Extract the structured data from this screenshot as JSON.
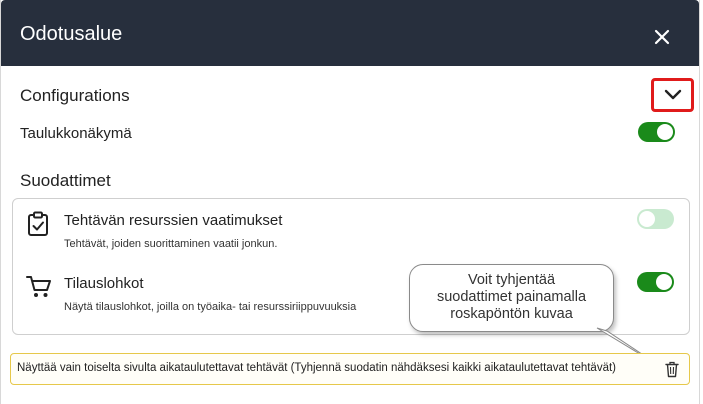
{
  "dialog": {
    "title": "Odotusalue",
    "close_icon": "close-icon"
  },
  "configurations": {
    "heading": "Configurations",
    "collapse_icon": "chevron-down-icon",
    "table_view": {
      "label": "Taulukkonäkymä",
      "enabled": true
    }
  },
  "filters": {
    "heading": "Suodattimet",
    "items": [
      {
        "icon": "clipboard-check-icon",
        "title": "Tehtävän resurssien vaatimukset",
        "description": "Tehtävät, joiden suorittaminen vaatii jonkun.",
        "enabled": false
      },
      {
        "icon": "shopping-cart-icon",
        "title": "Tilauslohkot",
        "description": "Näytä tilauslohkot, joilla on työaika- tai resurssiriippuvuuksia",
        "enabled": true
      }
    ]
  },
  "tooltip": {
    "lines": [
      "Voit tyhjentää",
      "suodattimet painamalla",
      "roskapöntön kuvaa"
    ]
  },
  "notice": {
    "text": "Näyttää vain toiselta sivulta aikataulutettavat tehtävät (Tyhjennä suodatin nähdäksesi kaikki aikataulutettavat tehtävät)",
    "clear_icon": "trash-icon"
  },
  "colors": {
    "header_bg": "#272f3d",
    "toggle_on": "#1a8a1a",
    "toggle_off": "#c9ead0",
    "highlight_border": "#e01b1b",
    "notice_border": "#e6c84a"
  }
}
